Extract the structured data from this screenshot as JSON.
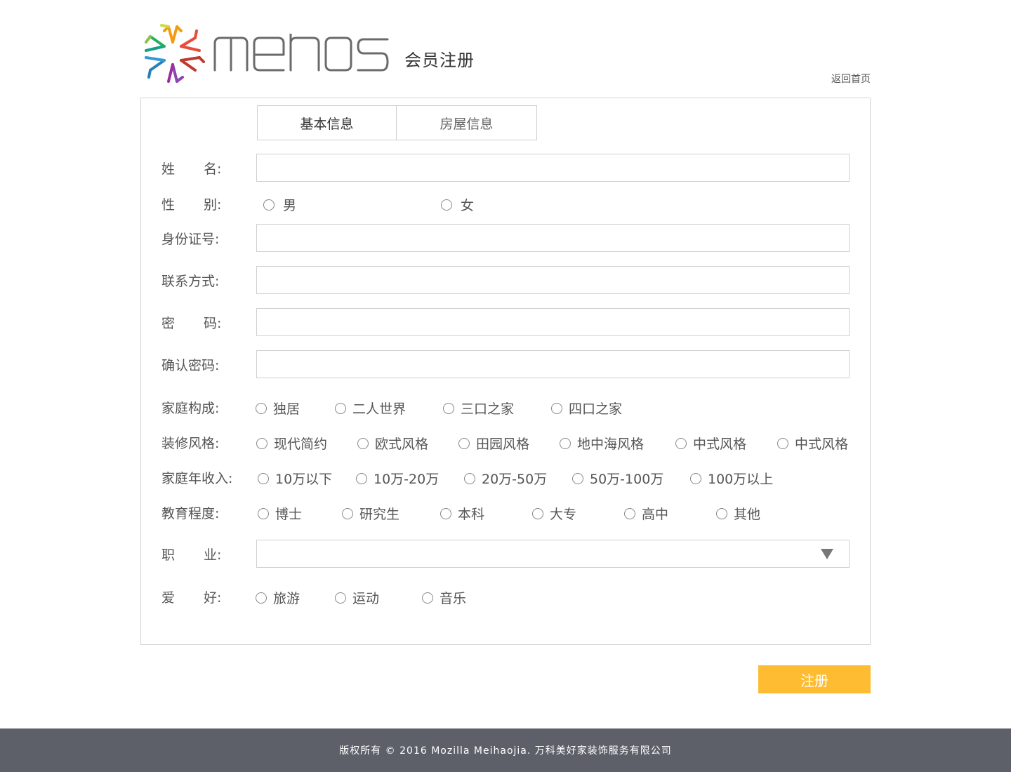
{
  "header": {
    "brand": "mehos",
    "title": "会员注册",
    "home_link": "返回首页"
  },
  "tabs": [
    {
      "label": "基本信息",
      "active": true
    },
    {
      "label": "房屋信息",
      "active": false
    }
  ],
  "form": {
    "name": {
      "label_a": "姓",
      "label_b": "名:",
      "value": ""
    },
    "gender": {
      "label_a": "性",
      "label_b": "别:",
      "options": [
        "男",
        "女"
      ]
    },
    "id_number": {
      "label": "身份证号:",
      "value": ""
    },
    "contact": {
      "label": "联系方式:",
      "value": ""
    },
    "password": {
      "label_a": "密",
      "label_b": "码:",
      "value": ""
    },
    "confirm_password": {
      "label": "确认密码:",
      "value": ""
    },
    "family": {
      "label": "家庭构成:",
      "options": [
        "独居",
        "二人世界",
        "三口之家",
        "四口之家"
      ]
    },
    "style": {
      "label": "装修风格:",
      "options": [
        "现代简约",
        "欧式风格",
        "田园风格",
        "地中海风格",
        "中式风格",
        "中式风格"
      ]
    },
    "income": {
      "label": "家庭年收入:",
      "options": [
        "10万以下",
        "10万-20万",
        "20万-50万",
        "50万-100万",
        "100万以上"
      ]
    },
    "education": {
      "label": "教育程度:",
      "options": [
        "博士",
        "研究生",
        "本科",
        "大专",
        "高中",
        "其他"
      ]
    },
    "occupation": {
      "label_a": "职",
      "label_b": "业:",
      "value": ""
    },
    "hobby": {
      "label_a": "爱",
      "label_b": "好:",
      "options": [
        "旅游",
        "运动",
        "音乐"
      ]
    }
  },
  "submit_label": "注册",
  "footer": {
    "copyright": "版权所有 © 2016 Mozilla Meihaojia. 万科美好家装饰服务有限公司"
  },
  "colors": {
    "accent": "#fdbc31",
    "footer_bg": "#5d6068",
    "border": "#cfcfcf"
  }
}
